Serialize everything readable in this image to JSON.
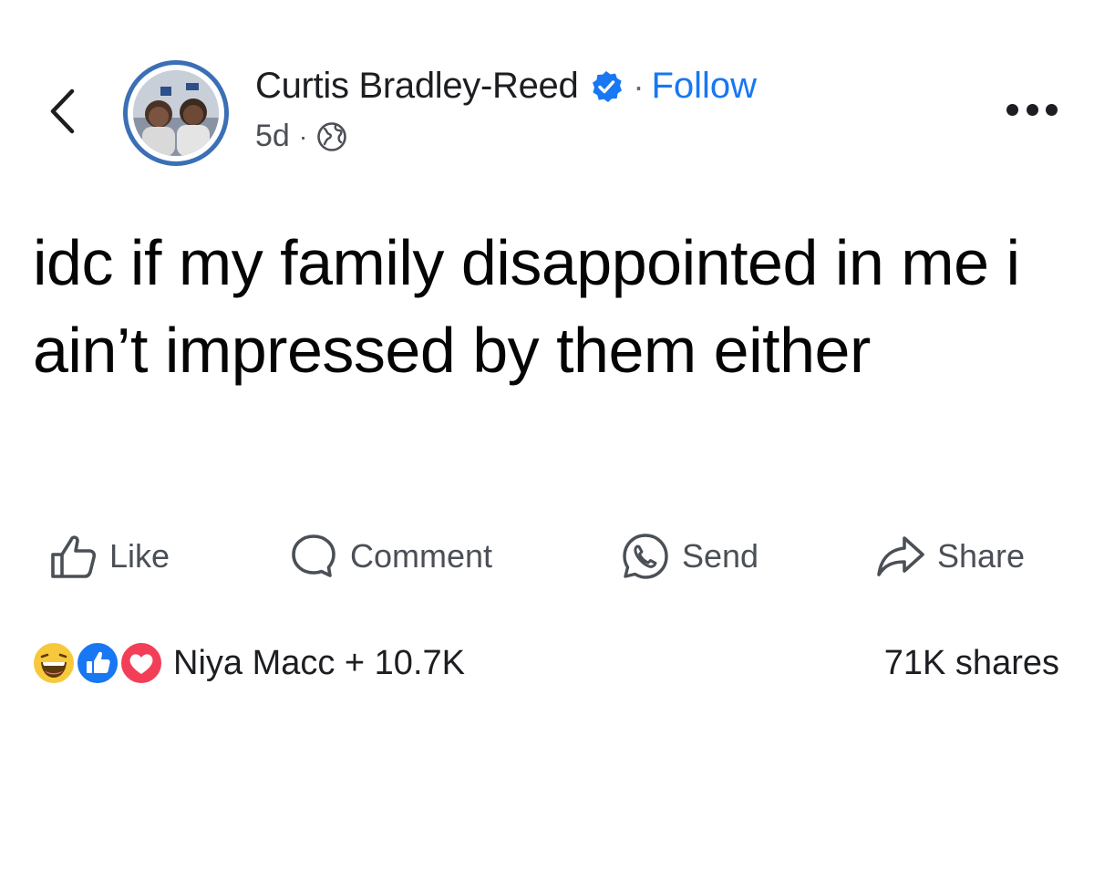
{
  "header": {
    "author_name": "Curtis Bradley-Reed",
    "separator": "·",
    "follow_label": "Follow",
    "timestamp": "5d",
    "meta_separator": "·",
    "privacy_icon": "globe-icon",
    "back_icon": "chevron-left-icon",
    "more_icon": "more-options-icon",
    "verified_icon": "verified-badge-icon"
  },
  "post": {
    "text": "idc if my family disappointed in me i ain’t impressed by them either"
  },
  "actions": [
    {
      "label": "Like",
      "icon": "like-icon"
    },
    {
      "label": "Comment",
      "icon": "comment-icon"
    },
    {
      "label": "Send",
      "icon": "send-icon"
    },
    {
      "label": "Share",
      "icon": "share-icon"
    }
  ],
  "engagement": {
    "reaction_icons": [
      "haha-reaction-icon",
      "like-reaction-icon",
      "love-reaction-icon"
    ],
    "reactors": "Niya Macc + 10.7K",
    "shares": "71K shares"
  },
  "colors": {
    "accent": "#1877f2",
    "text": "#1c1e21",
    "secondary_text": "#4b4f56",
    "avatar_ring": "#3b6fb6",
    "like_reaction": "#1877f2",
    "love_reaction": "#f33e58",
    "haha_reaction": "#f7c93a"
  }
}
